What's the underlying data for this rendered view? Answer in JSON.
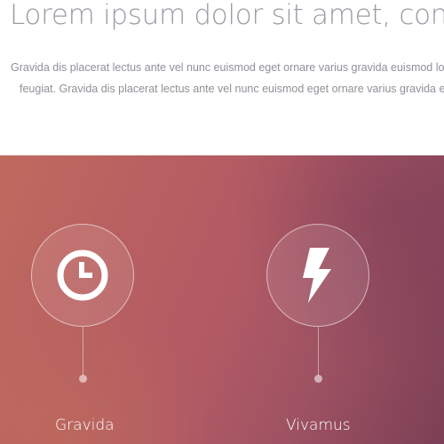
{
  "intro": {
    "headline": "Lorem ipsum dolor sit amet, consectetur",
    "paragraph_line_1": "Gravida dis placerat lectus ante vel nunc euismod eget ornare varius gravida euismod lorem",
    "paragraph_line_2": "feugiat. Gravida dis placerat lectus ante vel nunc euismod eget ornare varius gravida euismod"
  },
  "features": [
    {
      "label": "Gravida",
      "icon": "clock-icon"
    },
    {
      "label": "Vivamus",
      "icon": "lightning-bolt-icon"
    }
  ],
  "colors": {
    "band_gradient_start": "#bf6a5f",
    "band_gradient_mid": "#b15a64",
    "band_gradient_end": "#7c3f55",
    "headline_text": "#9a9ca3",
    "body_text": "#8f9198"
  }
}
